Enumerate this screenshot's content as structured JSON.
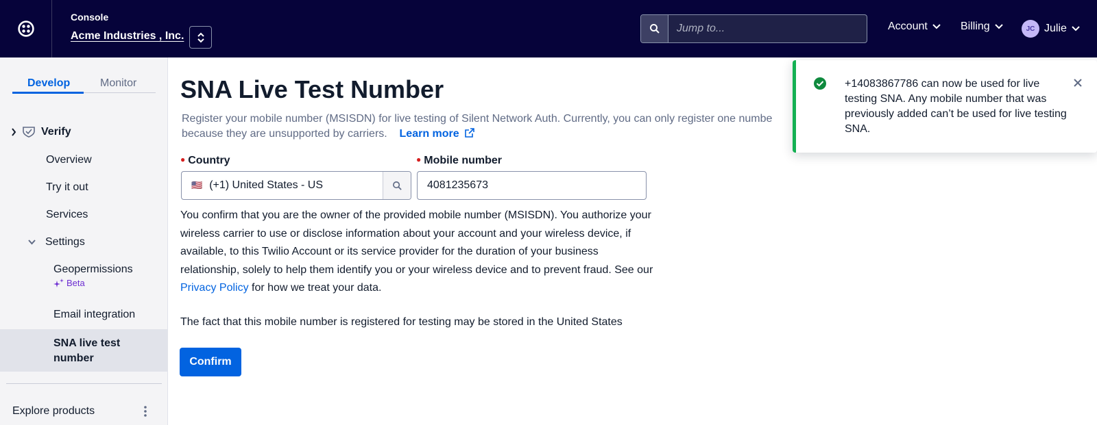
{
  "header": {
    "console_label": "Console",
    "account_name": "Acme Industries , Inc.",
    "search_placeholder": "Jump to...",
    "menu": {
      "account": "Account",
      "billing": "Billing",
      "user_initials": "JC",
      "user_name": "Julie"
    }
  },
  "sidebar": {
    "tabs": [
      "Develop",
      "Monitor"
    ],
    "active_tab": "Develop",
    "section": "Verify",
    "items": {
      "overview": "Overview",
      "try_it_out": "Try it out",
      "services": "Services",
      "settings": "Settings",
      "geopermissions": "Geopermissions",
      "beta_badge": "Beta",
      "email_integration": "Email integration",
      "sna_line1": "SNA live test",
      "sna_line2": "number"
    },
    "selected_item": "SNA live test number",
    "explore_products": "Explore products"
  },
  "main": {
    "title": "SNA Live Test Number",
    "intro_line1": "Register your mobile number (MSISDN) for live testing of Silent Network Auth. Currently, you can only register one numbe",
    "intro_line2": "because they are unsupported by carriers.",
    "learn_more": "Learn more",
    "country_label": "Country",
    "country_flag": "🇺🇸",
    "country_value": "(+1) United States - US",
    "mobile_label": "Mobile number",
    "mobile_value": "4081235673",
    "consent_before_link": "You confirm that you are the owner of the provided mobile number (MSISDN). You authorize your wireless carrier to use or disclose information about your account and your wireless device, if available, to this Twilio Account or its service provider for the duration of your business relationship, solely to help them identify you or your wireless device and to prevent fraud. See our ",
    "privacy_policy": "Privacy Policy",
    "consent_after_link": " for how we treat your data.",
    "storage_note": "The fact that this mobile number is registered for testing may be stored in the United States",
    "confirm_label": "Confirm"
  },
  "toast": {
    "message": "+14083867786 can now be used for live testing SNA. Any mobile number that was previously added can’t be used for live testing SNA.",
    "status": "success"
  },
  "colors": {
    "topbar": "#06033a",
    "primary": "#0263e0",
    "success": "#14b053",
    "beta": "#6d2ed1",
    "required": "#d61f1f"
  }
}
